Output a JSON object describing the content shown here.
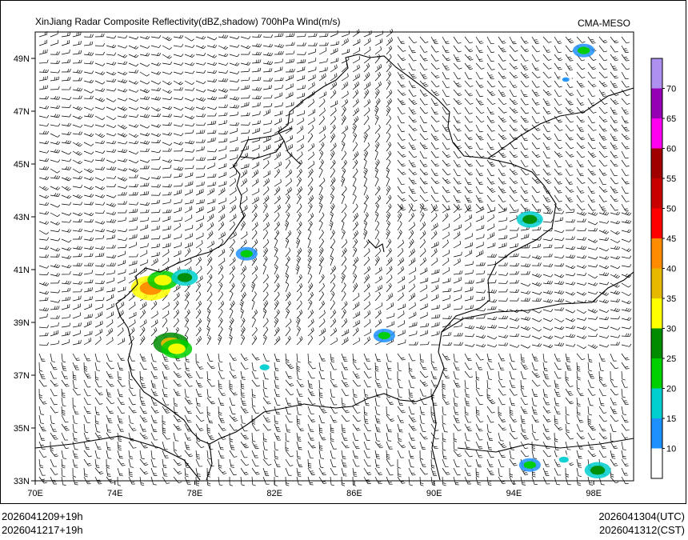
{
  "title": "XinJiang Radar Composite Reflectivity(dBZ,shadow) 700hPa Wind(m/s)",
  "organization": "CMA-MESO",
  "footer": {
    "left_line1": "2026041209+19h",
    "left_line2": "2026041217+19h",
    "right_line1": "2026041304(UTC)",
    "right_line2": "2026041312(CST)"
  },
  "map": {
    "lon_range": [
      70,
      100
    ],
    "lat_range": [
      33,
      50
    ],
    "lat_labels": [
      "49N",
      "47N",
      "45N",
      "43N",
      "41N",
      "39N",
      "37N",
      "35N",
      "33N"
    ],
    "lat_values": [
      49,
      47,
      45,
      43,
      41,
      39,
      37,
      35,
      33
    ],
    "lon_labels": [
      "70E",
      "74E",
      "78E",
      "82E",
      "86E",
      "90E",
      "94E",
      "98E"
    ],
    "lon_values": [
      70,
      74,
      78,
      82,
      86,
      90,
      94,
      98
    ]
  },
  "colorbar": {
    "levels": [
      "10",
      "15",
      "20",
      "25",
      "30",
      "35",
      "40",
      "45",
      "50",
      "55",
      "60",
      "65",
      "70"
    ],
    "colors": [
      "#ffffff",
      "#1e90ff",
      "#00cfd0",
      "#00d000",
      "#008c00",
      "#ffff00",
      "#e6b800",
      "#ff8c00",
      "#ff0000",
      "#c80000",
      "#a00000",
      "#ff00f0",
      "#9600b4",
      "#ad90f0"
    ]
  },
  "echoes": [
    {
      "lon": 75.8,
      "lat": 40.3,
      "dbz": 40
    },
    {
      "lon": 76.4,
      "lat": 40.6,
      "dbz": 30
    },
    {
      "lon": 77.5,
      "lat": 40.7,
      "dbz": 25
    },
    {
      "lon": 76.8,
      "lat": 38.2,
      "dbz": 35
    },
    {
      "lon": 77.1,
      "lat": 38.0,
      "dbz": 30
    },
    {
      "lon": 94.8,
      "lat": 33.6,
      "dbz": 20
    },
    {
      "lon": 96.5,
      "lat": 33.8,
      "dbz": 15
    },
    {
      "lon": 98.2,
      "lat": 33.4,
      "dbz": 25
    },
    {
      "lon": 97.5,
      "lat": 49.3,
      "dbz": 20
    },
    {
      "lon": 96.6,
      "lat": 48.2,
      "dbz": 10
    },
    {
      "lon": 94.8,
      "lat": 42.9,
      "dbz": 25
    },
    {
      "lon": 80.6,
      "lat": 41.6,
      "dbz": 20
    },
    {
      "lon": 81.5,
      "lat": 37.3,
      "dbz": 15
    },
    {
      "lon": 87.5,
      "lat": 38.5,
      "dbz": 20
    }
  ]
}
